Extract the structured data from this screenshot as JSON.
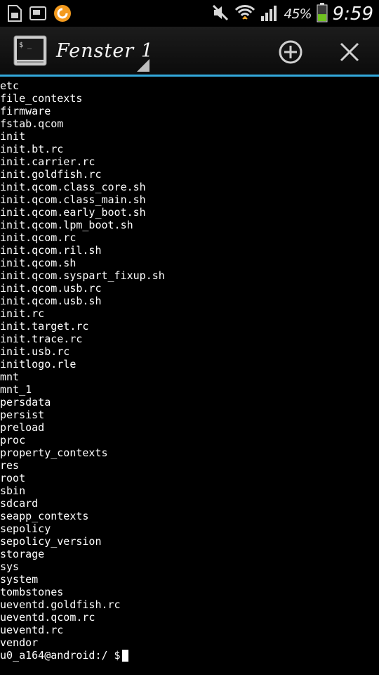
{
  "status_bar": {
    "left_icons": [
      "sd-card-icon",
      "screenshot-icon",
      "orange-app-icon"
    ],
    "right_icons": [
      "mute-icon",
      "wifi-icon",
      "signal-icon",
      "battery-icon"
    ],
    "battery_percent": "45%",
    "time": "9:59",
    "battery_level": 0.45
  },
  "action_bar": {
    "title": "Fenster 1",
    "icons": {
      "add": "add-circle-icon",
      "close": "close-icon"
    },
    "accent_color": "#33a9dc"
  },
  "terminal": {
    "lines": [
      "etc",
      "file_contexts",
      "firmware",
      "fstab.qcom",
      "init",
      "init.bt.rc",
      "init.carrier.rc",
      "init.goldfish.rc",
      "init.qcom.class_core.sh",
      "init.qcom.class_main.sh",
      "init.qcom.early_boot.sh",
      "init.qcom.lpm_boot.sh",
      "init.qcom.rc",
      "init.qcom.ril.sh",
      "init.qcom.sh",
      "init.qcom.syspart_fixup.sh",
      "init.qcom.usb.rc",
      "init.qcom.usb.sh",
      "init.rc",
      "init.target.rc",
      "init.trace.rc",
      "init.usb.rc",
      "initlogo.rle",
      "mnt",
      "mnt_1",
      "persdata",
      "persist",
      "preload",
      "proc",
      "property_contexts",
      "res",
      "root",
      "sbin",
      "sdcard",
      "seapp_contexts",
      "sepolicy",
      "sepolicy_version",
      "storage",
      "sys",
      "system",
      "tombstones",
      "ueventd.goldfish.rc",
      "ueventd.qcom.rc",
      "ueventd.rc",
      "vendor"
    ],
    "prompt": "u0_a164@android:/ $"
  }
}
